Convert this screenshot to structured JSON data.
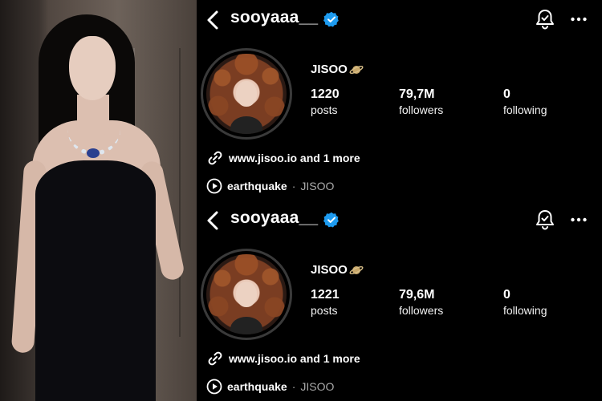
{
  "profiles": [
    {
      "username": "sooyaaa__",
      "display_name": "JISOO",
      "name_emoji": "planet-emoji",
      "stats": {
        "posts_value": "1220",
        "posts_label": "posts",
        "followers_value": "79,7M",
        "followers_label": "followers",
        "following_value": "0",
        "following_label": "following"
      },
      "link_text": "www.jisoo.io and 1 more",
      "music": {
        "song": "earthquake",
        "separator": "·",
        "artist": "JISOO"
      }
    },
    {
      "username": "sooyaaa__",
      "display_name": "JISOO",
      "name_emoji": "planet-emoji",
      "stats": {
        "posts_value": "1221",
        "posts_label": "posts",
        "followers_value": "79,6M",
        "followers_label": "followers",
        "following_value": "0",
        "following_label": "following"
      },
      "link_text": "www.jisoo.io and 1 more",
      "music": {
        "song": "earthquake",
        "separator": "·",
        "artist": "JISOO"
      }
    }
  ],
  "colors": {
    "verified_blue": "#1d9bf0",
    "background": "#000000",
    "muted_text": "#aaaaaa"
  },
  "icons": [
    "back-arrow-icon",
    "verified-badge-icon",
    "notification-bell-icon",
    "more-options-icon",
    "link-icon",
    "play-icon"
  ]
}
